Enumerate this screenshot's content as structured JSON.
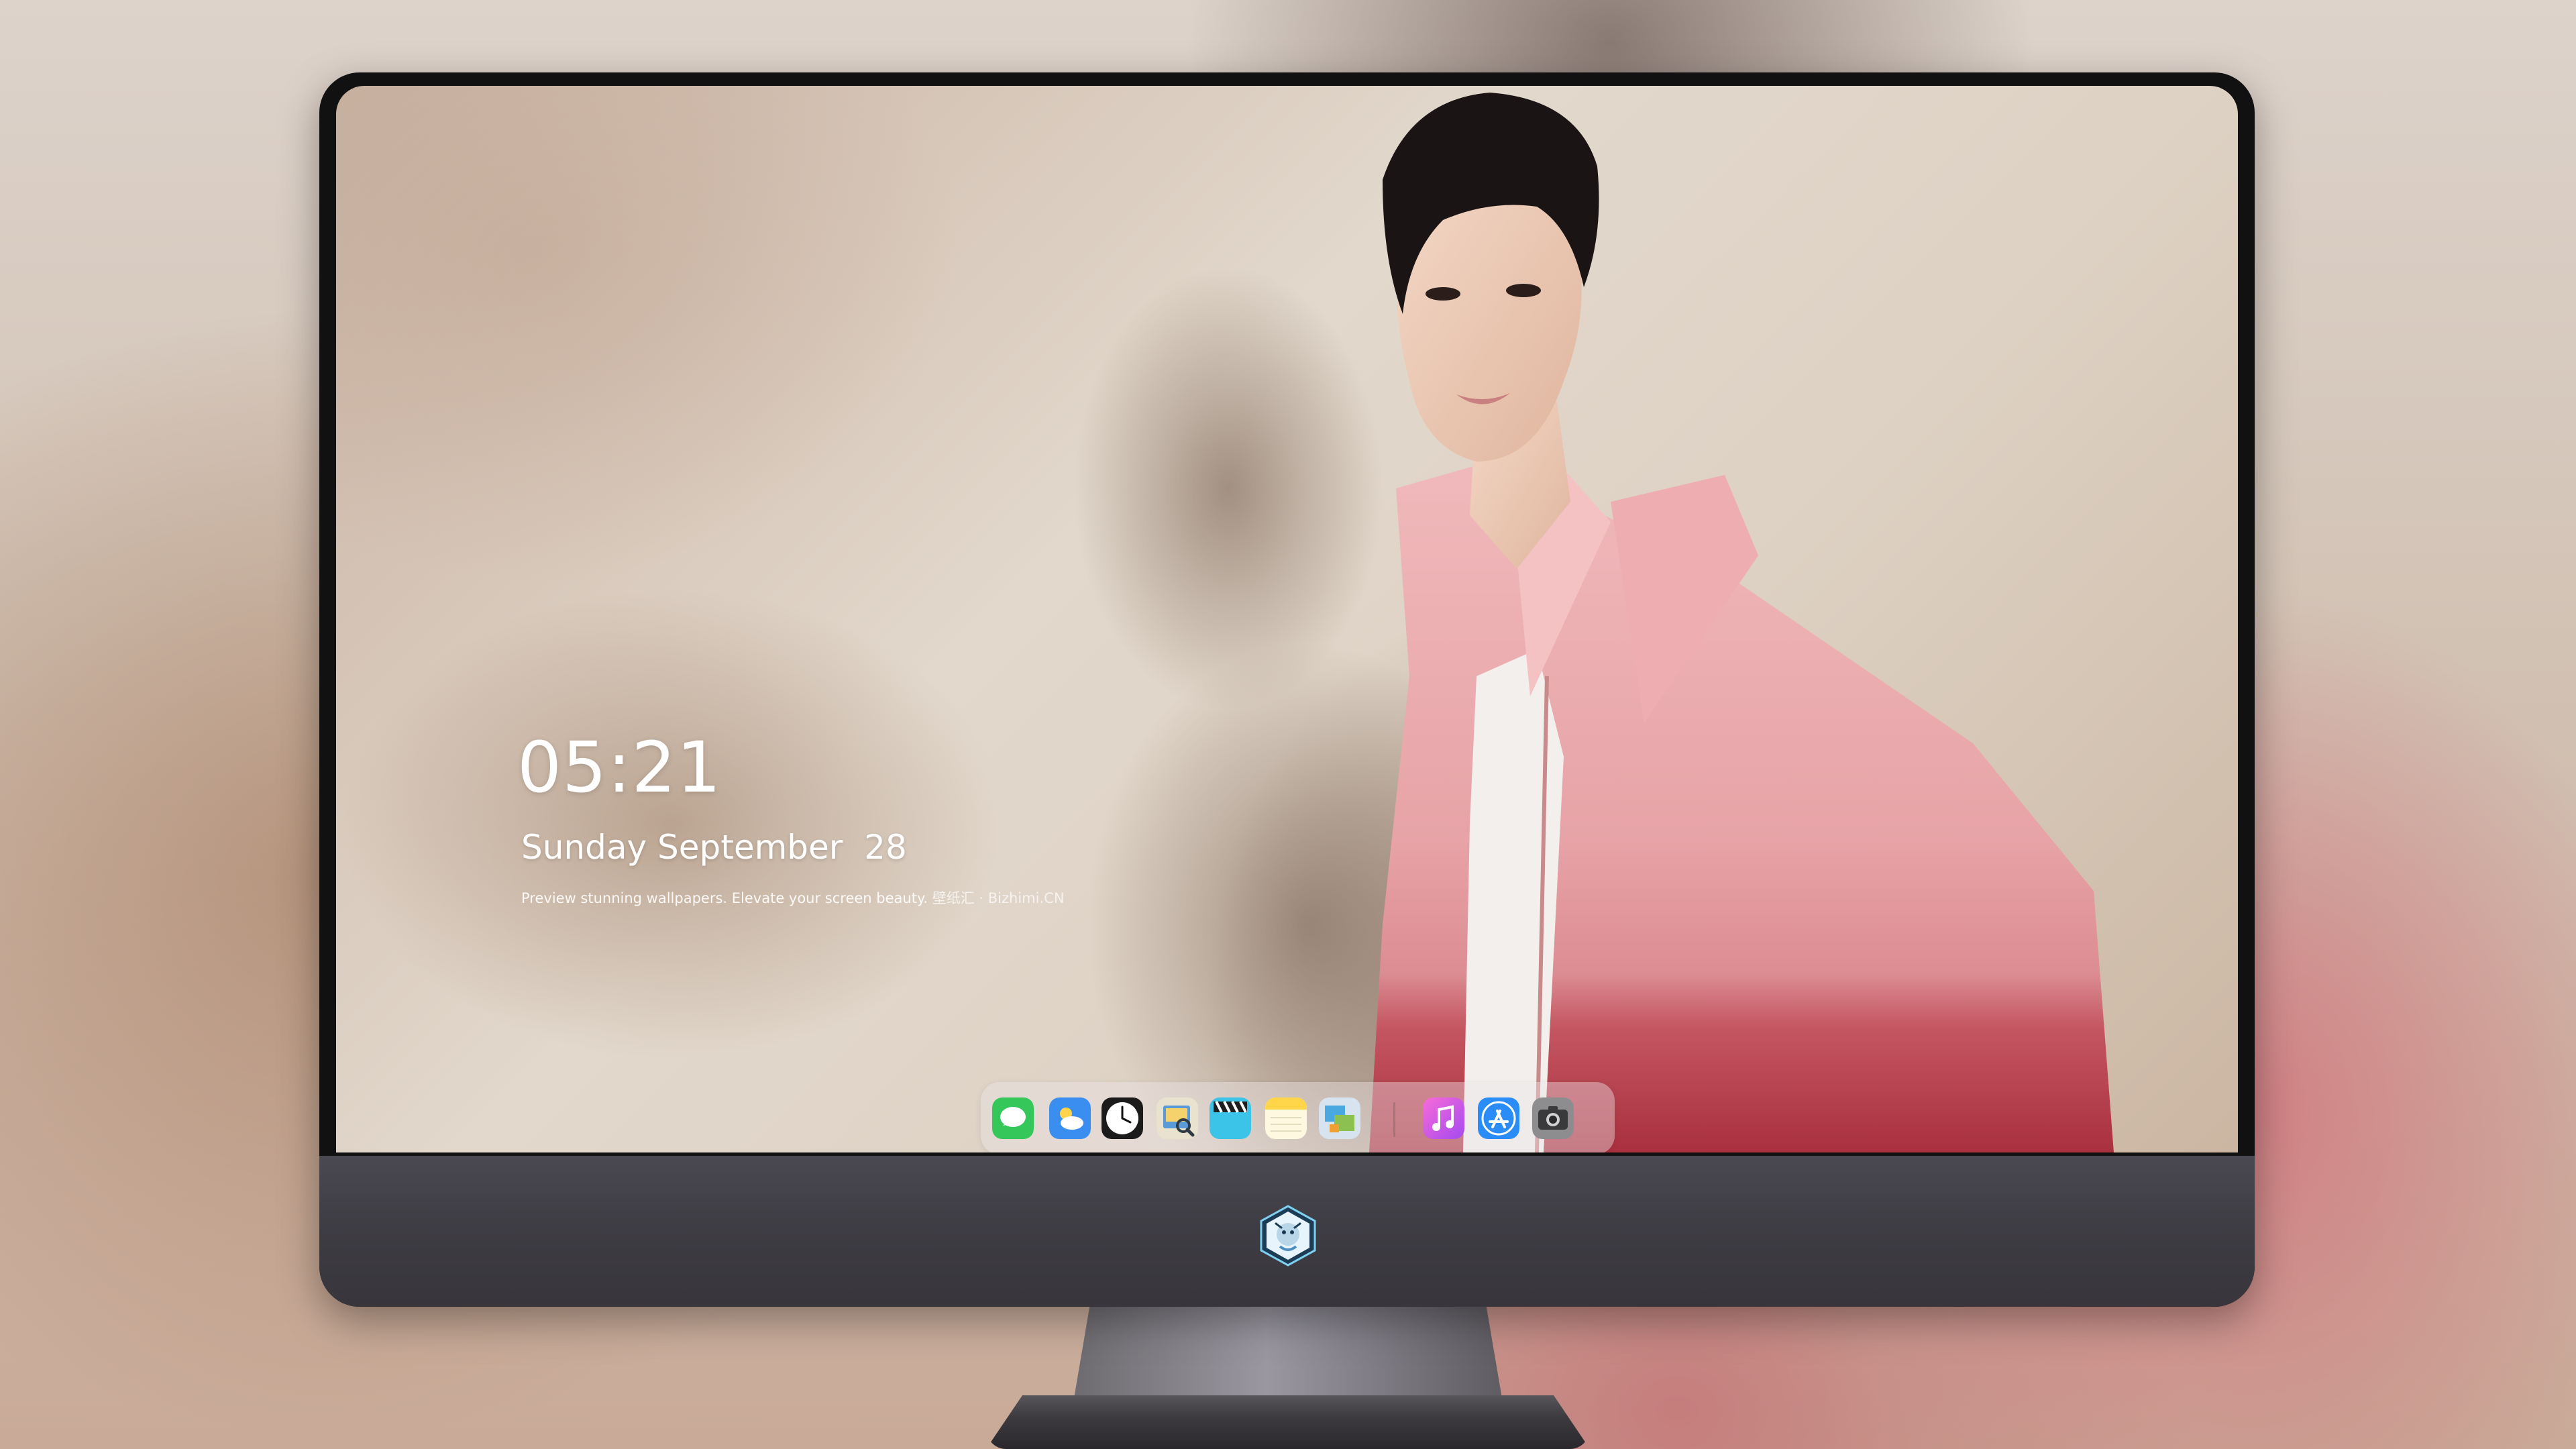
{
  "lock_screen": {
    "time": "05:21",
    "date": "Sunday September  28",
    "tagline": "Preview stunning wallpapers. Elevate your screen beauty.",
    "tagline_brand": "壁纸汇 · Bizhimi.CN"
  },
  "dock": {
    "items": [
      {
        "name": "messages-icon",
        "color": "#35c759"
      },
      {
        "name": "weather-icon",
        "color": "#3a8ef0"
      },
      {
        "name": "clock-icon",
        "color": "#1b1b1b"
      },
      {
        "name": "preview-icon",
        "color": "#e8e2cf"
      },
      {
        "name": "video-editor-icon",
        "color": "#3cc3e8"
      },
      {
        "name": "notes-icon",
        "color": "#ffd54a"
      },
      {
        "name": "image-capture-icon",
        "color": "#d7e3ef"
      },
      {
        "name": "music-icon",
        "color": "#f45fd3"
      },
      {
        "name": "app-store-icon",
        "color": "#2a8cf7"
      },
      {
        "name": "camera-icon",
        "color": "#6e6e70"
      }
    ]
  },
  "colors": {
    "bezel": "#111111",
    "chin": "#3e3c43",
    "jacket": "#e9a9ad",
    "jacket_dye": "#b8424d"
  }
}
